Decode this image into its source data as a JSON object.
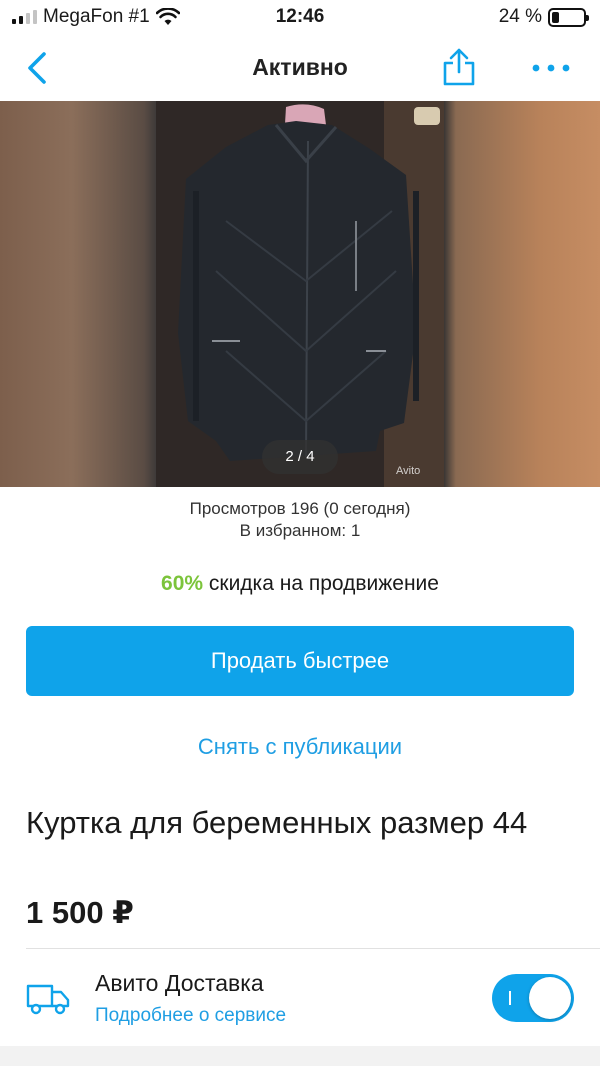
{
  "status_bar": {
    "carrier": "MegaFon #1",
    "time": "12:46",
    "battery_percent": "24 %",
    "battery_level": 0.24
  },
  "nav": {
    "title": "Активно",
    "back_icon": "chevron-left-icon",
    "share_icon": "share-icon",
    "more_icon": "more-dots-icon"
  },
  "photo": {
    "counter": "2 / 4",
    "watermark": "Avito"
  },
  "stats": {
    "views": "Просмотров 196 (0 сегодня)",
    "favorites": "В избранном: 1"
  },
  "promo": {
    "percent": "60%",
    "text": " скидка на продвижение"
  },
  "actions": {
    "sell_faster": "Продать быстрее",
    "unpublish": "Снять с публикации"
  },
  "listing": {
    "title": "Куртка для беременных размер 44",
    "price": "1 500 ₽"
  },
  "delivery": {
    "title": "Авито Доставка",
    "link": "Подробнее о сервисе",
    "enabled": true,
    "icon": "truck-icon"
  },
  "colors": {
    "accent": "#0fa3ea",
    "link": "#1f9ee3",
    "promo_green": "#7cc43b"
  }
}
